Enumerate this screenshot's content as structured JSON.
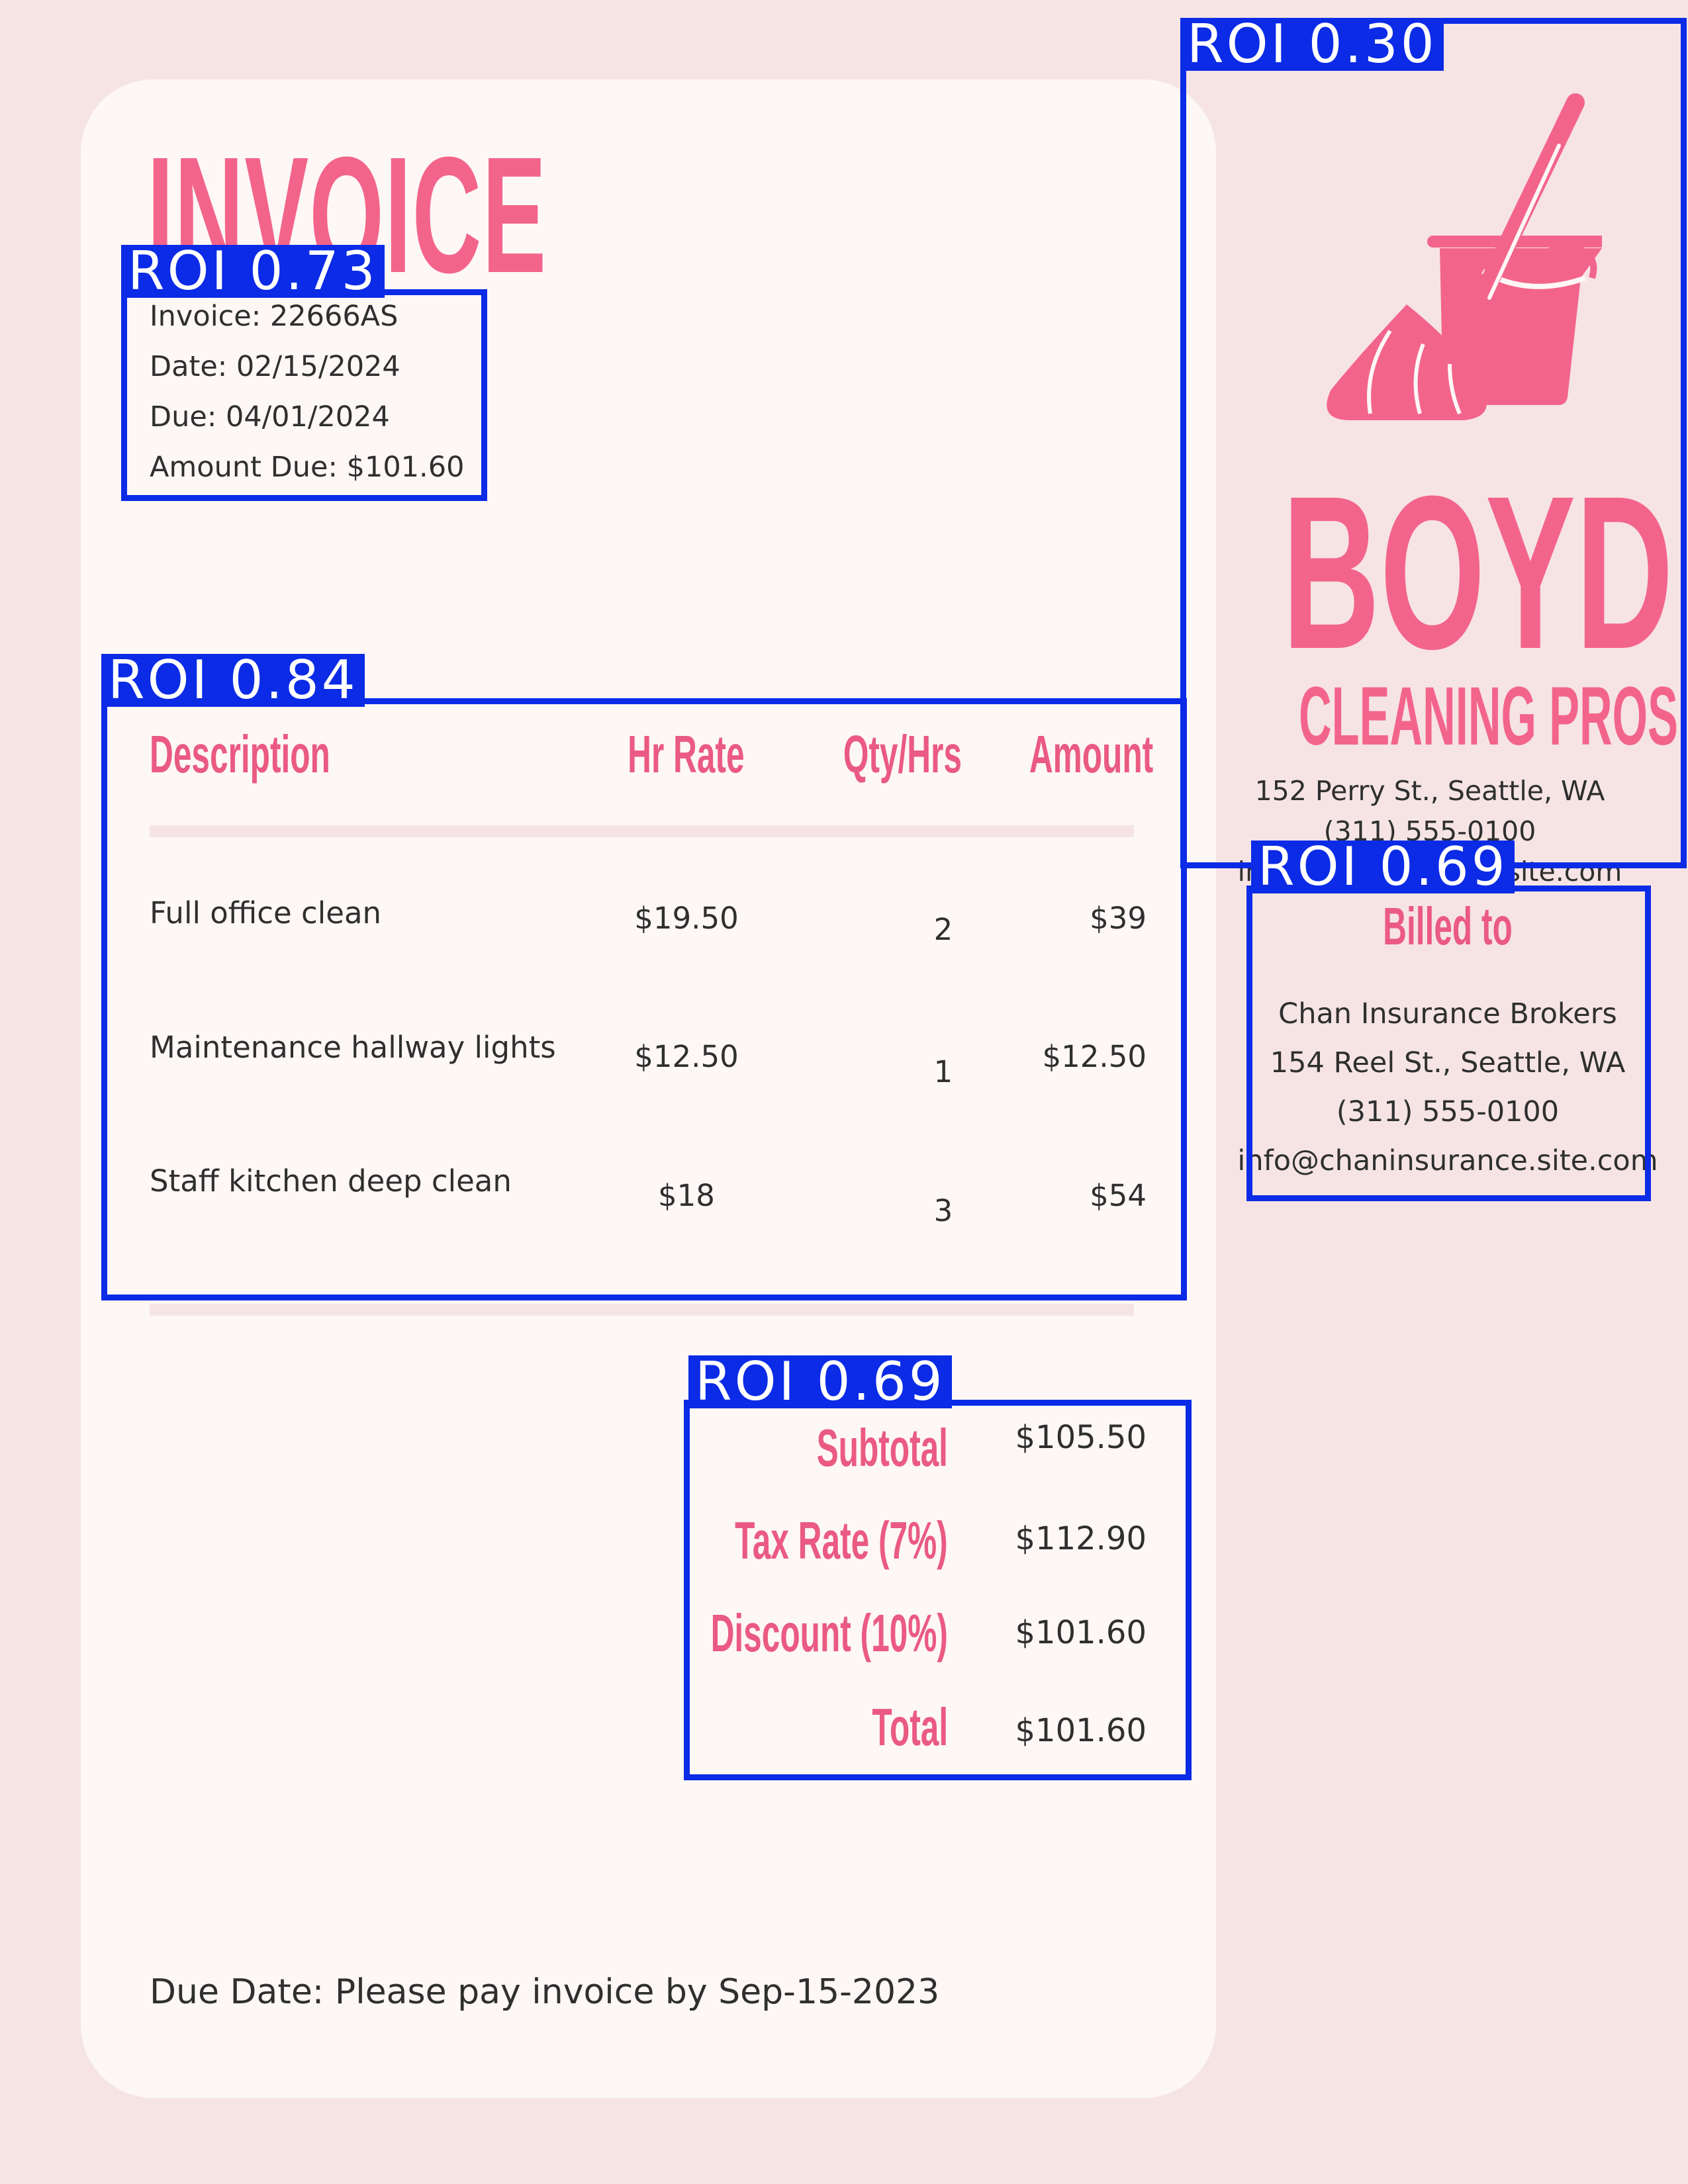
{
  "invoice": {
    "title": "INVOICE",
    "number_line": "Invoice: 22666AS",
    "date_line": "Date: 02/15/2024",
    "due_line": "Due: 04/01/2024",
    "amount_due_line": "Amount Due: $101.60"
  },
  "table": {
    "headers": {
      "description": "Description",
      "rate": "Hr Rate",
      "qty": "Qty/Hrs",
      "amount": "Amount"
    },
    "rows": [
      {
        "description": "Full office clean",
        "rate": "$19.50",
        "qty": "2",
        "amount": "$39"
      },
      {
        "description": "Maintenance hallway lights",
        "rate": "$12.50",
        "qty": "1",
        "amount": "$12.50"
      },
      {
        "description": "Staff kitchen deep clean",
        "rate": "$18",
        "qty": "3",
        "amount": "$54"
      }
    ]
  },
  "totals": {
    "subtotal_label": "Subtotal",
    "subtotal_value": "$105.50",
    "tax_label": "Tax Rate (7%)",
    "tax_value": "$112.90",
    "discount_label": "Discount (10%)",
    "discount_value": "$101.60",
    "total_label": "Total",
    "total_value": "$101.60"
  },
  "footer": {
    "note": "Due Date: Please pay invoice by Sep-15-2023"
  },
  "company": {
    "name": "BOYD",
    "tagline": "CLEANING PROS",
    "address": "152 Perry St., Seattle, WA",
    "phone": "(311) 555-0100",
    "email": "info@boydcleaning.site.com",
    "logo_icon": "mop-and-bucket-icon"
  },
  "billed_to": {
    "title": "Billed to",
    "name": "Chan Insurance Brokers",
    "address": "154 Reel St., Seattle, WA",
    "phone": "(311) 555-0100",
    "email": "info@chaninsurance.site.com"
  },
  "roi_labels": {
    "logo": "ROI 0.30",
    "invoice_meta": "ROI 0.73",
    "items_table": "ROI 0.84",
    "billed_to": "ROI 0.69",
    "totals": "ROI 0.69"
  },
  "colors": {
    "accent": "#f3648b",
    "background": "#f6e4e4",
    "card": "#fdf7f6",
    "roi": "#0b2be6",
    "text": "#2f2f2f"
  }
}
